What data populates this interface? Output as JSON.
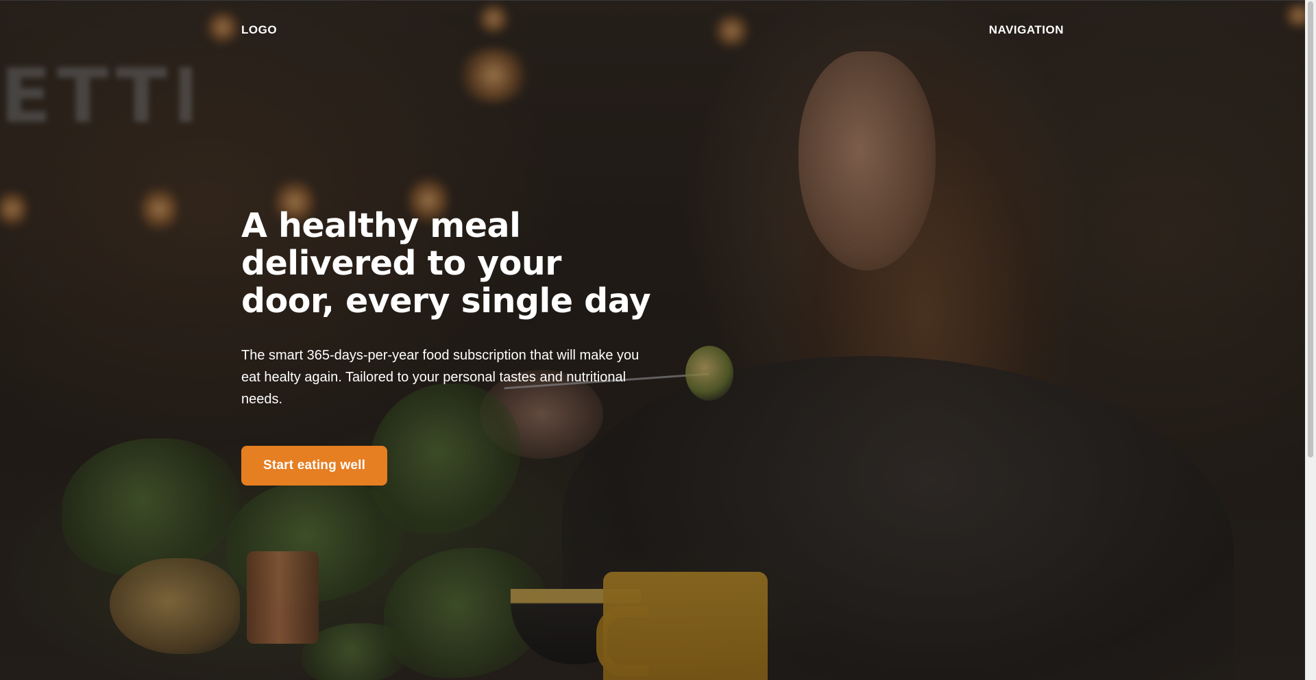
{
  "header": {
    "logo": "LOGO",
    "navigation": "NAVIGATION"
  },
  "hero": {
    "title": "A healthy meal delivered to your door, every single day",
    "text": "The smart 365-days-per-year food subscription that will make you eat healty again. Tailored to your personal tastes and nutritional needs.",
    "cta_label": "Start eating well",
    "background_image": "woman-eating-meal-photo"
  },
  "colors": {
    "accent": "#e67e22",
    "text": "#ffffff",
    "overlay": "#14100e"
  }
}
